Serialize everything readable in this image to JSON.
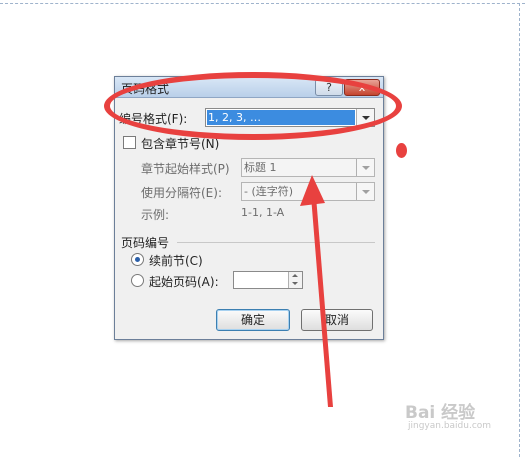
{
  "dialog": {
    "title": "页码格式",
    "help_label": "?",
    "close_label": "x",
    "number_format_label": "编号格式(F):",
    "number_format_value": "1, 2, 3, …",
    "include_chapter_label": "包含章节号(N)",
    "chapter_start_style_label": "章节起始样式(P)",
    "chapter_start_style_value": "标题 1",
    "separator_label": "使用分隔符(E):",
    "separator_value": "-   (连字符)",
    "example_label": "示例:",
    "example_value": "1-1, 1-A",
    "page_numbering_label": "页码编号",
    "continue_label": "续前节(C)",
    "start_at_label": "起始页码(A):",
    "start_at_value": "",
    "ok_label": "确定",
    "cancel_label": "取消"
  },
  "watermark": {
    "brand": "Bai 经验",
    "url": "jingyan.baidu.com"
  },
  "colors": {
    "annotation": "#e8413f",
    "selection": "#3c8ce0"
  }
}
